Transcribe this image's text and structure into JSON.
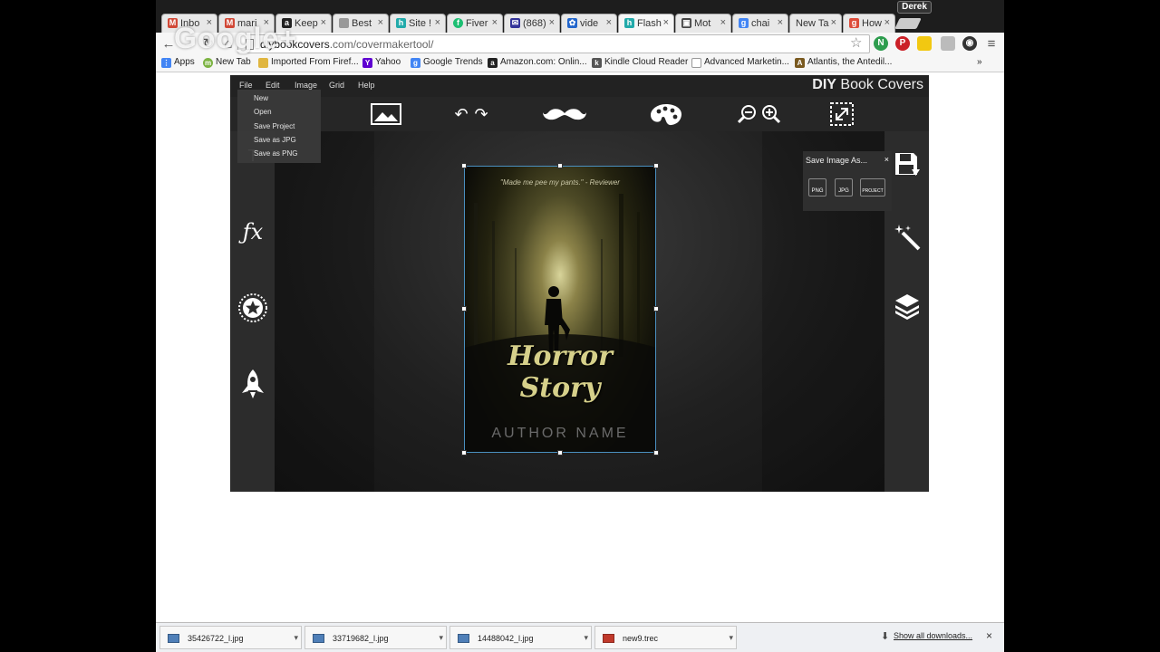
{
  "browser": {
    "profile": "Derek",
    "tabs": [
      {
        "label": "Inbo",
        "fav": "M",
        "color": "#d14836"
      },
      {
        "label": "mari",
        "fav": "M",
        "color": "#d14836"
      },
      {
        "label": "Keep",
        "fav": "a",
        "color": "#222"
      },
      {
        "label": "Best",
        "fav": "",
        "color": "#999"
      },
      {
        "label": "Site !",
        "fav": "h",
        "color": "#2aa"
      },
      {
        "label": "Fiver",
        "fav": "f",
        "color": "#1dbf73"
      },
      {
        "label": "(868)",
        "fav": "✉",
        "color": "#333399"
      },
      {
        "label": "vide",
        "fav": "✿",
        "color": "#2266cc"
      },
      {
        "label": "Flash",
        "fav": "h",
        "color": "#2aa"
      },
      {
        "label": "Mot",
        "fav": "▣",
        "color": "#444"
      },
      {
        "label": "chai",
        "fav": "g",
        "color": "#4285f4"
      },
      {
        "label": "New Ta",
        "fav": "",
        "color": "#fff"
      },
      {
        "label": "How",
        "fav": "g",
        "color": "#dd4b39"
      }
    ],
    "url_host": "diybookcovers",
    "url_path": ".com/covermakertool/",
    "watermark": "Google+",
    "bookmarks": [
      {
        "label": "Apps",
        "color": "#4285f4",
        "icon": "⋮"
      },
      {
        "label": "New Tab",
        "color": "#7cb342",
        "icon": "m"
      },
      {
        "label": "Imported From Firef...",
        "color": "#e0b640",
        "icon": ""
      },
      {
        "label": "Yahoo",
        "color": "#5f01d1",
        "icon": "Y"
      },
      {
        "label": "Google Trends",
        "color": "#4285f4",
        "icon": "g"
      },
      {
        "label": "Amazon.com: Onlin...",
        "color": "#222",
        "icon": "a"
      },
      {
        "label": "Kindle Cloud Reader",
        "color": "#555",
        "icon": "k"
      },
      {
        "label": "Advanced Marketin...",
        "color": "#999",
        "icon": ""
      },
      {
        "label": "Atlantis, the Antedil...",
        "color": "#7a5a20",
        "icon": "A"
      }
    ],
    "bookmarks_overflow": "»"
  },
  "app": {
    "menus": [
      "File",
      "Edit",
      "Image",
      "Grid",
      "Help"
    ],
    "brand_bold": "DIY",
    "brand_rest": " Book Covers",
    "file_menu": [
      "New",
      "Open",
      "Save Project",
      "Save as JPG",
      "Save as PNG"
    ],
    "cover": {
      "quote": "\"Made me pee my pants.\" - Reviewer",
      "title": "Horror Story",
      "author": "AUTHOR NAME"
    },
    "save_popup": {
      "title": "Save Image As...",
      "close": "×",
      "formats": [
        "PNG",
        "JPG",
        "PROJECT"
      ]
    }
  },
  "downloads": {
    "items": [
      "35426722_l.jpg",
      "33719682_l.jpg",
      "14488042_l.jpg",
      "new9.trec"
    ],
    "show_all": "Show all downloads...",
    "close": "×"
  }
}
